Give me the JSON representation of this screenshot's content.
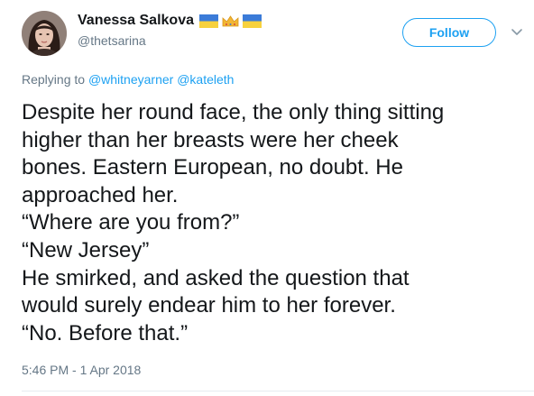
{
  "user": {
    "name": "Vanessa Salkova",
    "handle": "@thetsarina",
    "emoji": [
      "flag-ukraine",
      "crown",
      "flag-ukraine"
    ]
  },
  "actions": {
    "follow_label": "Follow",
    "more_icon": "chevron-down-icon"
  },
  "reply": {
    "prefix": "Replying to",
    "mentions": [
      "@whitneyarner",
      "@kateleth"
    ]
  },
  "tweet": {
    "lines": [
      "Despite her round face, the only thing sitting",
      "higher than her breasts were her cheek",
      "bones. Eastern European, no doubt. He",
      "approached her.",
      "“Where are you from?”",
      "“New Jersey”",
      "He smirked, and asked the question that",
      "would surely endear him to her forever.",
      "“No. Before that.”"
    ]
  },
  "timestamp": "5:46 PM - 1 Apr 2018",
  "colors": {
    "accent": "#1da1f2",
    "secondary_text": "#657786",
    "primary_text": "#14171a"
  }
}
